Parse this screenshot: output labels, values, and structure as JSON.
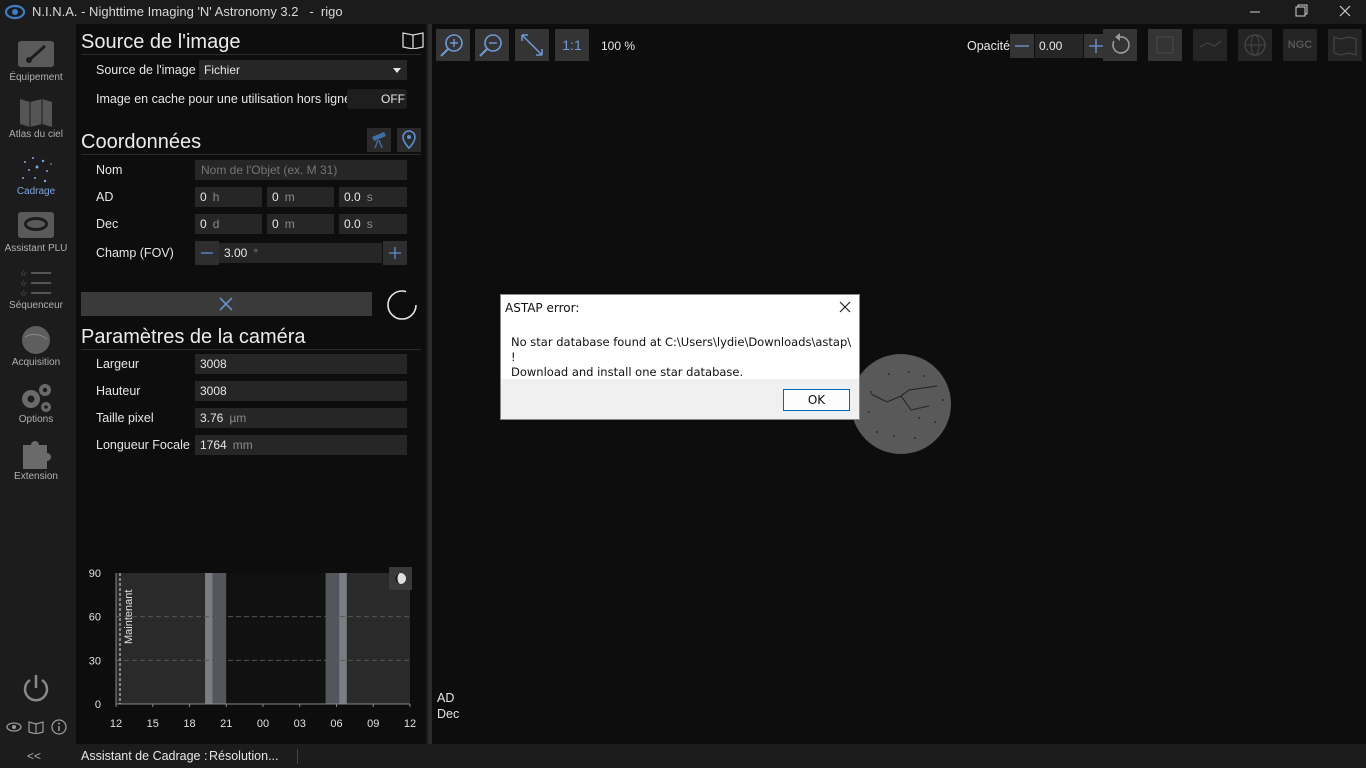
{
  "window": {
    "title": "N.I.N.A. - Nighttime Imaging 'N' Astronomy 3.2   -  rigo"
  },
  "nav": {
    "items": [
      {
        "label": "Équipement",
        "icon": "equipment-icon"
      },
      {
        "label": "Atlas du ciel",
        "icon": "sky-atlas-icon"
      },
      {
        "label": "Cadrage",
        "icon": "framing-icon",
        "active": true
      },
      {
        "label": "Assistant PLU",
        "icon": "flat-wizard-icon"
      },
      {
        "label": "Séquenceur",
        "icon": "sequencer-icon"
      },
      {
        "label": "Acquisition",
        "icon": "imaging-icon"
      },
      {
        "label": "Options",
        "icon": "options-icon"
      },
      {
        "label": "Extension",
        "icon": "plugin-icon"
      }
    ],
    "collapse_label": "<<"
  },
  "image_source": {
    "heading": "Source de l'image",
    "source_label": "Source de l'image",
    "source_value": "Fichier",
    "cache_label": "Image en cache pour une utilisation hors ligne",
    "cache_toggle": "OFF"
  },
  "coordinates": {
    "heading": "Coordonnées",
    "name_label": "Nom",
    "name_placeholder": "Nom de l'Objet (ex. M 31)",
    "ra_label": "AD",
    "ra_h": "0",
    "ra_h_unit": "h",
    "ra_m": "0",
    "ra_m_unit": "m",
    "ra_s": "0.0",
    "ra_s_unit": "s",
    "dec_label": "Dec",
    "dec_d": "0",
    "dec_d_unit": "d",
    "dec_m": "0",
    "dec_m_unit": "m",
    "dec_s": "0.0",
    "dec_s_unit": "s",
    "fov_label": "Champ (FOV)",
    "fov_value": "3.00",
    "fov_unit": "°"
  },
  "camera": {
    "heading": "Paramètres de la caméra",
    "width_label": "Largeur",
    "width_value": "3008",
    "height_label": "Hauteur",
    "height_value": "3008",
    "pixel_label": "Taille pixel",
    "pixel_value": "3.76",
    "pixel_unit": "µm",
    "focal_label": "Longueur Focale",
    "focal_value": "1764",
    "focal_unit": "mm"
  },
  "chart_data": {
    "type": "area",
    "ylim": [
      0,
      90
    ],
    "yticks": [
      "90",
      "60",
      "30",
      "0"
    ],
    "xticks": [
      "12",
      "15",
      "18",
      "21",
      "00",
      "03",
      "06",
      "09",
      "12"
    ],
    "now_label": "Maintenant"
  },
  "toolbar": {
    "zoom_label": "100 %",
    "one_to_one": "1:1",
    "opacity_label": "Opacité",
    "opacity_value": "0.00",
    "ngc_label": "NGC"
  },
  "image_area": {
    "ra_label": "AD",
    "dec_label": "Dec"
  },
  "statusbar": {
    "label": "Assistant de Cadrage :",
    "value": "Résolution..."
  },
  "dialog": {
    "title": "ASTAP error:",
    "line1": "No star database found at C:\\Users\\lydie\\Downloads\\astap\\ !",
    "line2": "Download and install one star database.",
    "ok": "OK"
  }
}
